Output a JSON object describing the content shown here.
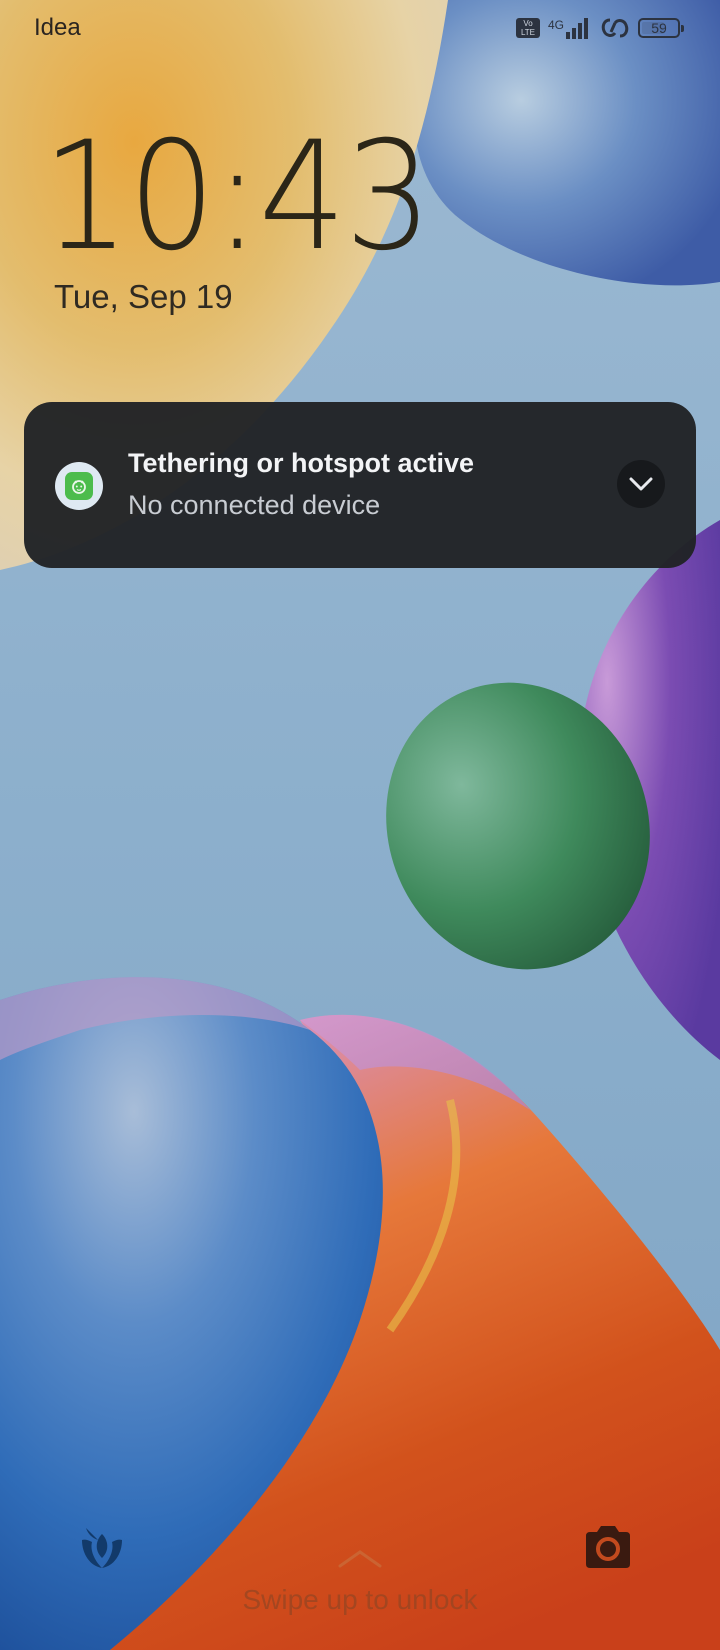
{
  "status_bar": {
    "carrier": "Idea",
    "volte_label": "Vo LTE",
    "network_type": "4G",
    "battery_level": "59",
    "icons": [
      "volte-icon",
      "signal-icon",
      "hotspot-icon",
      "battery-icon"
    ]
  },
  "lock_screen": {
    "time": "10:43",
    "date": "Tue, Sep 19"
  },
  "notification": {
    "app_icon": "hotspot-app-icon",
    "title": "Tethering or hotspot active",
    "text": "No connected device",
    "expand_icon": "chevron-down-icon"
  },
  "bottom": {
    "left_shortcut_icon": "tulip-icon",
    "right_shortcut_icon": "camera-icon",
    "swipe_hint": "Swipe up to unlock"
  },
  "colors": {
    "notification_bg": "#212326",
    "app_icon_green": "#4cbc4c",
    "clock_text": "#2b2618"
  }
}
